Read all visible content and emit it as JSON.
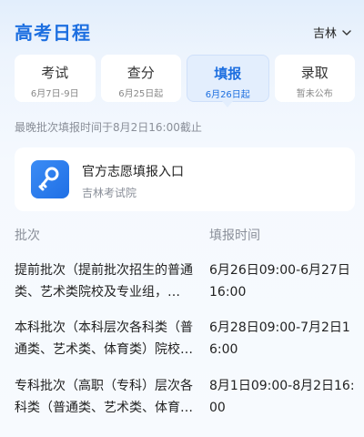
{
  "header": {
    "title": "高考日程",
    "region": "吉林"
  },
  "tabs": [
    {
      "label": "考试",
      "sub": "6月7日-9日"
    },
    {
      "label": "查分",
      "sub": "6月25日起"
    },
    {
      "label": "填报",
      "sub": "6月26日起"
    },
    {
      "label": "录取",
      "sub": "暂未公布"
    }
  ],
  "active_tab": "填报",
  "deadline": "最晚批次填报时间于8月2日16:00截止",
  "portal": {
    "title": "官方志愿填报入口",
    "subtitle": "吉林考试院"
  },
  "table": {
    "headers": [
      "批次",
      "填报时间"
    ],
    "rows": [
      {
        "batch": "提前批次（提前批次招生的普通类、艺术类院校及专业组，…",
        "time": "6月26日09:00-6月27日16:00"
      },
      {
        "batch": "本科批次（本科层次各科类（普通类、艺术类、体育类）院校…",
        "time": "6月28日09:00-7月2日16:00"
      },
      {
        "batch": "专科批次（高职（专科）层次各科类（普通类、艺术类、体育…",
        "time": "8月1日09:00-8月2日16:00"
      }
    ]
  },
  "colors": {
    "accent": "#1d6fe0",
    "muted": "#8a8f99",
    "active_tab_bg": "#e3eefd"
  }
}
